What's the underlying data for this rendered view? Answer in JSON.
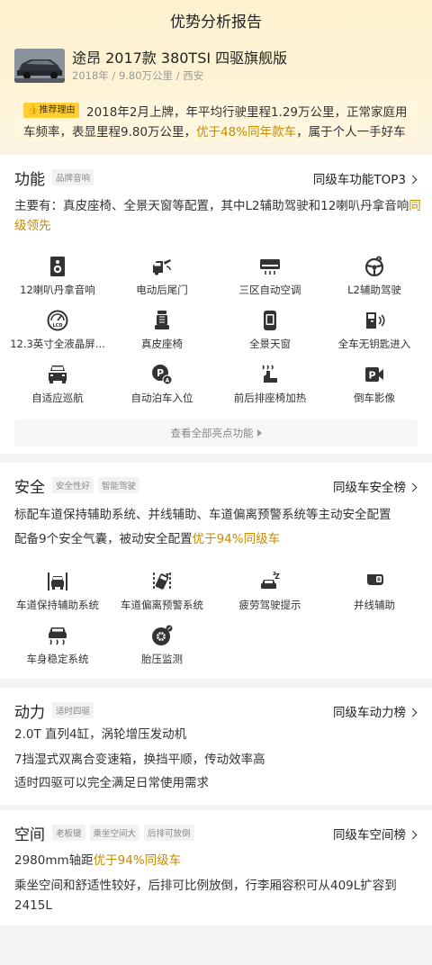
{
  "header": {
    "title": "优势分析报告"
  },
  "car": {
    "name": "途昂 2017款 380TSI 四驱旗舰版",
    "meta": "2018年 / 9.80万公里 / 西安"
  },
  "reason": {
    "tag": "推荐理由",
    "text_before": "2018年2月上牌，年平均行驶里程1.29万公里，正常家庭用车频率，表显里程9.80万公里，",
    "highlight": "优于48%同年款车",
    "text_after": "，属于个人一手好车"
  },
  "features": {
    "title": "功能",
    "tags": [
      "品牌音响"
    ],
    "link": "同级车功能TOP3",
    "desc_before": "主要有：真皮座椅、全景天窗等配置，其中L2辅助驾驶和12喇叭丹拿音响",
    "desc_highlight": "同级领先",
    "items": [
      {
        "label": "12喇叭丹拿音响",
        "icon": "speaker-icon"
      },
      {
        "label": "电动后尾门",
        "icon": "power-tailgate-icon"
      },
      {
        "label": "三区自动空调",
        "icon": "air-conditioner-icon"
      },
      {
        "label": "L2辅助驾驶",
        "icon": "steering-wheel-icon"
      },
      {
        "label": "12.3英寸全液晶屏...",
        "icon": "lcd-dashboard-icon"
      },
      {
        "label": "真皮座椅",
        "icon": "leather-seat-icon"
      },
      {
        "label": "全景天窗",
        "icon": "sunroof-icon"
      },
      {
        "label": "全车无钥匙进入",
        "icon": "keyless-entry-icon"
      },
      {
        "label": "自适应巡航",
        "icon": "adaptive-cruise-icon"
      },
      {
        "label": "自动泊车入位",
        "icon": "auto-parking-icon"
      },
      {
        "label": "前后排座椅加热",
        "icon": "seat-heating-icon"
      },
      {
        "label": "倒车影像",
        "icon": "reverse-camera-icon"
      }
    ],
    "more": "查看全部亮点功能"
  },
  "safety": {
    "title": "安全",
    "tags": [
      "安全性好",
      "智能驾驶"
    ],
    "link": "同级车安全榜",
    "line1": "标配车道保持辅助系统、并线辅助、车道偏离预警系统等主动安全配置",
    "line2_before": "配备9个安全气囊，被动安全配置",
    "line2_highlight": "优于94%同级车",
    "items": [
      {
        "label": "车道保持辅助系统",
        "icon": "lane-keeping-icon"
      },
      {
        "label": "车道偏离预警系统",
        "icon": "lane-departure-icon"
      },
      {
        "label": "疲劳驾驶提示",
        "icon": "fatigue-alert-icon"
      },
      {
        "label": "并线辅助",
        "icon": "blind-spot-icon"
      },
      {
        "label": "车身稳定系统",
        "icon": "stability-control-icon"
      },
      {
        "label": "胎压监测",
        "icon": "tire-pressure-icon"
      }
    ]
  },
  "power": {
    "title": "动力",
    "tags": [
      "适时四驱"
    ],
    "link": "同级车动力榜",
    "lines": [
      "2.0T 直列4缸，涡轮增压发动机",
      "7挡湿式双离合变速箱，换挡平顺，传动效率高",
      "适时四驱可以完全满足日常使用需求"
    ]
  },
  "space": {
    "title": "空间",
    "tags": [
      "老板键",
      "乘坐空间大",
      "后排可放倒"
    ],
    "link": "同级车空间榜",
    "line1_before": "2980mm轴距",
    "line1_highlight": "优于94%同级车",
    "line2": "乘坐空间和舒适性较好，后排可比例放倒，行李厢容积可从409L扩容到2415L"
  },
  "colors": {
    "highlight": "#c48a00",
    "tag_yellow": "#ffcf33",
    "hero": "#fdf1cf"
  }
}
